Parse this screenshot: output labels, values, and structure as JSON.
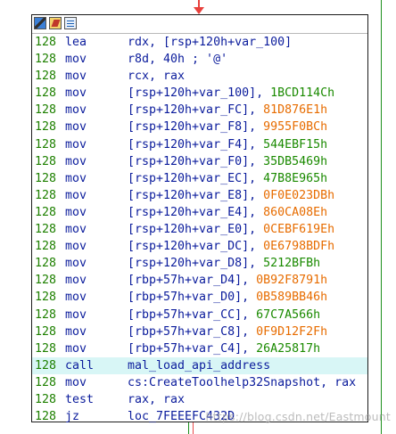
{
  "titlebar": {
    "buttons": [
      {
        "icon": "color-palette-icon"
      },
      {
        "icon": "edit-node-icon"
      },
      {
        "icon": "graph-view-icon"
      }
    ]
  },
  "lines": [
    {
      "addr": "128",
      "mnemonic": "lea",
      "operands": "rdx, [rsp+120h+var_100]",
      "value": "",
      "value_color": "",
      "highlighted": false
    },
    {
      "addr": "128",
      "mnemonic": "mov",
      "operands": "r8d, 40h ; '@'",
      "value": "",
      "value_color": "",
      "highlighted": false
    },
    {
      "addr": "128",
      "mnemonic": "mov",
      "operands": "rcx, rax",
      "value": "",
      "value_color": "",
      "highlighted": false
    },
    {
      "addr": "128",
      "mnemonic": "mov",
      "operands": "[rsp+120h+var_100], ",
      "value": "1BCD114Ch",
      "value_color": "green",
      "highlighted": false
    },
    {
      "addr": "128",
      "mnemonic": "mov",
      "operands": "[rsp+120h+var_FC], ",
      "value": "81D876E1h",
      "value_color": "orange",
      "highlighted": false
    },
    {
      "addr": "128",
      "mnemonic": "mov",
      "operands": "[rsp+120h+var_F8], ",
      "value": "9955F0BCh",
      "value_color": "orange",
      "highlighted": false
    },
    {
      "addr": "128",
      "mnemonic": "mov",
      "operands": "[rsp+120h+var_F4], ",
      "value": "544EBF15h",
      "value_color": "green",
      "highlighted": false
    },
    {
      "addr": "128",
      "mnemonic": "mov",
      "operands": "[rsp+120h+var_F0], ",
      "value": "35DB5469h",
      "value_color": "green",
      "highlighted": false
    },
    {
      "addr": "128",
      "mnemonic": "mov",
      "operands": "[rsp+120h+var_EC], ",
      "value": "47B8E965h",
      "value_color": "green",
      "highlighted": false
    },
    {
      "addr": "128",
      "mnemonic": "mov",
      "operands": "[rsp+120h+var_E8], ",
      "value": "0F0E023DBh",
      "value_color": "orange",
      "highlighted": false
    },
    {
      "addr": "128",
      "mnemonic": "mov",
      "operands": "[rsp+120h+var_E4], ",
      "value": "860CA08Eh",
      "value_color": "orange",
      "highlighted": false
    },
    {
      "addr": "128",
      "mnemonic": "mov",
      "operands": "[rsp+120h+var_E0], ",
      "value": "0CEBF619Eh",
      "value_color": "orange",
      "highlighted": false
    },
    {
      "addr": "128",
      "mnemonic": "mov",
      "operands": "[rsp+120h+var_DC], ",
      "value": "0E6798BDFh",
      "value_color": "orange",
      "highlighted": false
    },
    {
      "addr": "128",
      "mnemonic": "mov",
      "operands": "[rsp+120h+var_D8], ",
      "value": "5212BFBh",
      "value_color": "green",
      "highlighted": false
    },
    {
      "addr": "128",
      "mnemonic": "mov",
      "operands": "[rbp+57h+var_D4], ",
      "value": "0B92F8791h",
      "value_color": "orange",
      "highlighted": false
    },
    {
      "addr": "128",
      "mnemonic": "mov",
      "operands": "[rbp+57h+var_D0], ",
      "value": "0B589BB46h",
      "value_color": "orange",
      "highlighted": false
    },
    {
      "addr": "128",
      "mnemonic": "mov",
      "operands": "[rbp+57h+var_CC], ",
      "value": "67C7A566h",
      "value_color": "green",
      "highlighted": false
    },
    {
      "addr": "128",
      "mnemonic": "mov",
      "operands": "[rbp+57h+var_C8], ",
      "value": "0F9D12F2Fh",
      "value_color": "orange",
      "highlighted": false
    },
    {
      "addr": "128",
      "mnemonic": "mov",
      "operands": "[rbp+57h+var_C4], ",
      "value": "26A25817h",
      "value_color": "green",
      "highlighted": false
    },
    {
      "addr": "128",
      "mnemonic": "call",
      "operands": "mal_load_api_address",
      "value": "",
      "value_color": "",
      "highlighted": true
    },
    {
      "addr": "128",
      "mnemonic": "mov",
      "operands": "cs:CreateToolhelp32Snapshot, rax",
      "value": "",
      "value_color": "",
      "highlighted": false
    },
    {
      "addr": "128",
      "mnemonic": "test",
      "operands": "rax, rax",
      "value": "",
      "value_color": "",
      "highlighted": false
    },
    {
      "addr": "128",
      "mnemonic": "jz",
      "operands": "loc_7FEEEFC432D",
      "value": "",
      "value_color": "",
      "highlighted": false
    }
  ],
  "watermark": "https://blog.csdn.net/Eastmount",
  "colors": {
    "address": "#1e8000",
    "mnemonic": "#0b1c9c",
    "value_green": "#1a8a00",
    "value_orange": "#e76c00",
    "highlight": "#d8f6f6",
    "edge_true": "#1c8f1c",
    "edge_false": "#e84b4b"
  }
}
